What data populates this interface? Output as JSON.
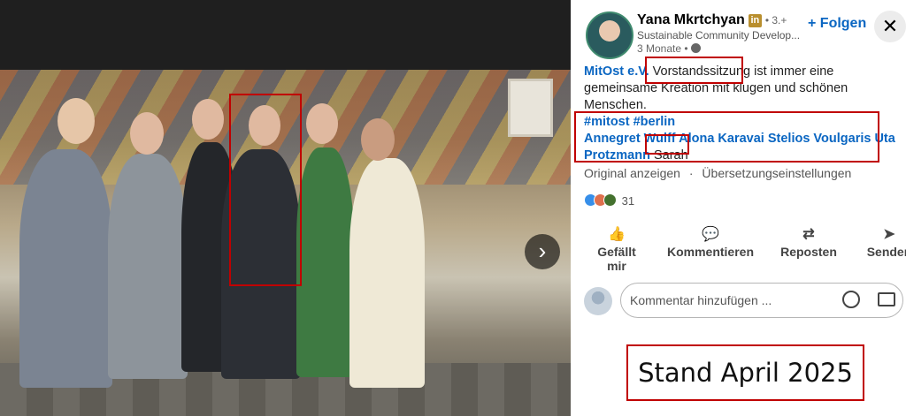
{
  "post": {
    "author_name": "Yana Mkrtchyan",
    "linkedin_badge": "in",
    "degree": "• 3.+",
    "headline": "Sustainable Community Develop...",
    "timestamp": "3 Monate •",
    "follow_label": "+ Folgen",
    "close_label": "✕",
    "org_link": "MitOst e.V.",
    "text_highlight": "Vorstandssitzung",
    "text_rest": "ist immer eine gemeinsame Kreation mit klugen und schönen Menschen.",
    "hashtags": "#mitost #berlin",
    "tagged_people": "Annegret Wulff Alona Karavai Stelios Voulgaris Uta Protzmann",
    "tagged_highlight": "Sarah",
    "show_original": "Original anzeigen",
    "separator": "·",
    "translation_settings": "Übersetzungseinstellungen",
    "reaction_count": "31"
  },
  "actions": {
    "like": "Gefällt mir",
    "comment": "Kommentieren",
    "repost": "Reposten",
    "send": "Senden"
  },
  "comment_input": {
    "placeholder": "Kommentar hinzufügen ..."
  },
  "viewer": {
    "next_label": "›"
  },
  "annotation": {
    "stand": "Stand April 2025"
  },
  "colors": {
    "link_blue": "#0a66c2",
    "highlight_red": "#c00000"
  }
}
